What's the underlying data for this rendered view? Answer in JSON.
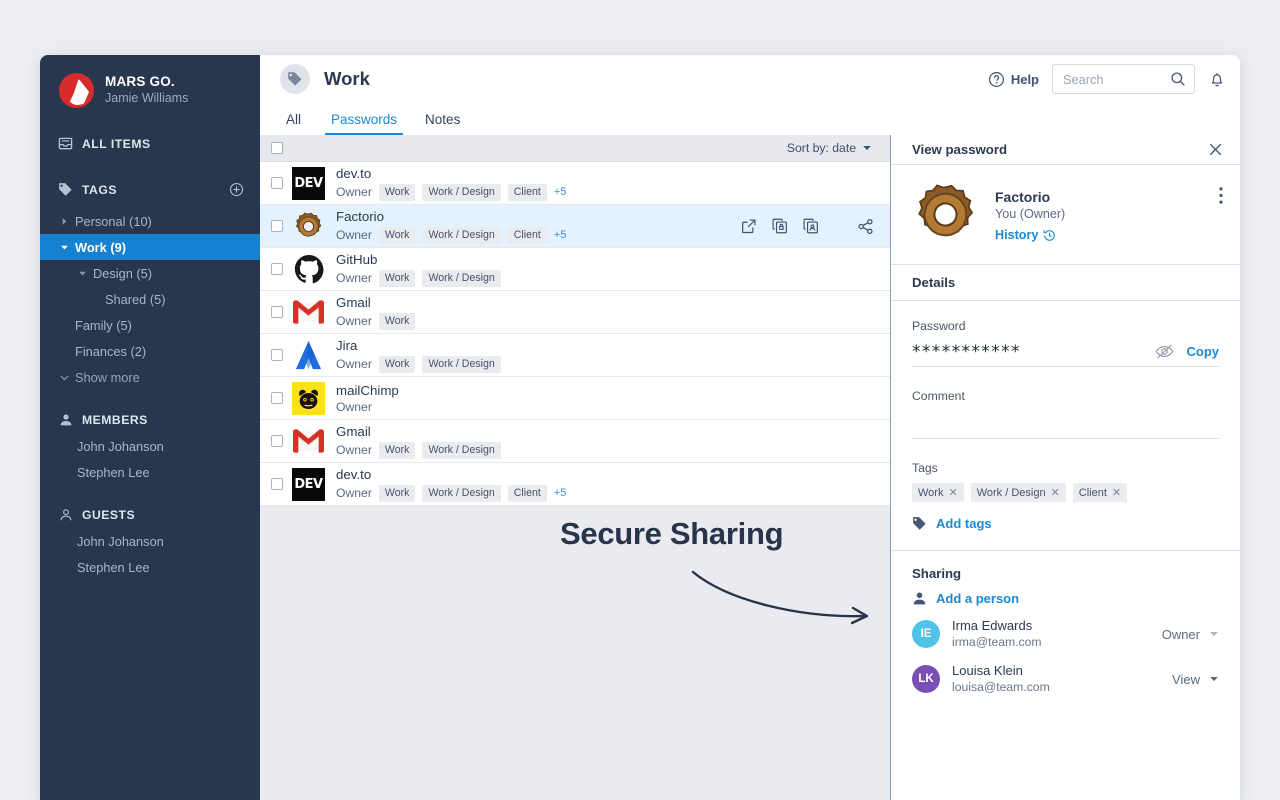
{
  "brand": {
    "name": "MARS GO.",
    "user": "Jamie Williams",
    "logo_color": "#d82b2b"
  },
  "sidebar": {
    "all_items": "ALL ITEMS",
    "tags_header": "TAGS",
    "add_tag_icon": "plus-circle-icon",
    "tags": [
      {
        "label": "Personal (10)",
        "level": 0,
        "caret": "right",
        "active": false
      },
      {
        "label": "Work (9)",
        "level": 0,
        "caret": "down",
        "active": true
      },
      {
        "label": "Design (5)",
        "level": 1,
        "caret": "down",
        "active": false
      },
      {
        "label": "Shared (5)",
        "level": 2,
        "caret": "none",
        "active": false
      },
      {
        "label": "Family (5)",
        "level": 0,
        "caret": "none",
        "active": false
      },
      {
        "label": "Finances (2)",
        "level": 0,
        "caret": "none",
        "active": false
      }
    ],
    "show_more": "Show more",
    "members_header": "MEMBERS",
    "members": [
      "John Johanson",
      "Stephen Lee"
    ],
    "guests_header": "GUESTS",
    "guests": [
      "John Johanson",
      "Stephen Lee"
    ]
  },
  "header": {
    "title": "Work",
    "tag_icon": "tag-icon",
    "help_label": "Help",
    "help_icon": "question-circle-icon",
    "search_placeholder": "Search",
    "search_value": "",
    "search_icon": "search-icon",
    "bell_icon": "bell-icon"
  },
  "tabs": [
    {
      "label": "All",
      "active": false
    },
    {
      "label": "Passwords",
      "active": true
    },
    {
      "label": "Notes",
      "active": false
    }
  ],
  "list": {
    "sort_label": "Sort by: date",
    "sort_caret_icon": "chevron-down-icon",
    "select_all_checkbox": false,
    "row_actions": [
      "external-link-icon",
      "copy-password-icon",
      "copy-username-icon",
      "share-icon"
    ],
    "rows": [
      {
        "name": "dev.to",
        "owner": "Owner",
        "icon": "devto-icon",
        "tags": [
          "Work",
          "Work / Design",
          "Client"
        ],
        "more": "+5",
        "selected": false
      },
      {
        "name": "Factorio",
        "owner": "Owner",
        "icon": "factorio-gear-icon",
        "tags": [
          "Work",
          "Work / Design",
          "Client"
        ],
        "more": "+5",
        "selected": true
      },
      {
        "name": "GitHub",
        "owner": "Owner",
        "icon": "github-icon",
        "tags": [
          "Work",
          "Work / Design"
        ],
        "more": "",
        "selected": false
      },
      {
        "name": "Gmail",
        "owner": "Owner",
        "icon": "gmail-icon",
        "tags": [
          "Work"
        ],
        "more": "",
        "selected": false
      },
      {
        "name": "Jira",
        "owner": "Owner",
        "icon": "jira-icon",
        "tags": [
          "Work",
          "Work / Design"
        ],
        "more": "",
        "selected": false
      },
      {
        "name": "mailChimp",
        "owner": "Owner",
        "icon": "mailchimp-icon",
        "tags": [],
        "more": "",
        "selected": false
      },
      {
        "name": "Gmail",
        "owner": "Owner",
        "icon": "gmail-icon",
        "tags": [
          "Work",
          "Work / Design"
        ],
        "more": "",
        "selected": false
      },
      {
        "name": "dev.to",
        "owner": "Owner",
        "icon": "devto-icon",
        "tags": [
          "Work",
          "Work / Design",
          "Client"
        ],
        "more": "+5",
        "selected": false
      }
    ]
  },
  "annotation": {
    "text": "Secure Sharing",
    "arrow_icon": "curved-arrow-icon"
  },
  "panel": {
    "header_title": "View password",
    "close_icon": "close-icon",
    "item_name": "Factorio",
    "item_role": "You (Owner)",
    "item_icon": "factorio-gear-icon",
    "history_label": "History",
    "history_icon": "clock-history-icon",
    "kebab_icon": "more-vertical-icon",
    "details_title": "Details",
    "password_label": "Password",
    "password_value": "***********",
    "eye_icon": "eye-off-icon",
    "copy_label": "Copy",
    "comment_label": "Comment",
    "comment_value": "",
    "tags_label": "Tags",
    "tags": [
      "Work",
      "Work / Design",
      "Client"
    ],
    "add_tags_label": "Add tags",
    "add_tags_icon": "tag-icon",
    "sharing_title": "Sharing",
    "add_person_label": "Add a person",
    "add_person_icon": "person-add-icon",
    "people": [
      {
        "initials": "IE",
        "name": "Irma Edwards",
        "email": "irma@team.com",
        "role": "Owner",
        "color": "#4fc3e8"
      },
      {
        "initials": "LK",
        "name": "Louisa Klein",
        "email": "louisa@team.com",
        "role": "View",
        "color": "#7a4fb5"
      }
    ]
  }
}
